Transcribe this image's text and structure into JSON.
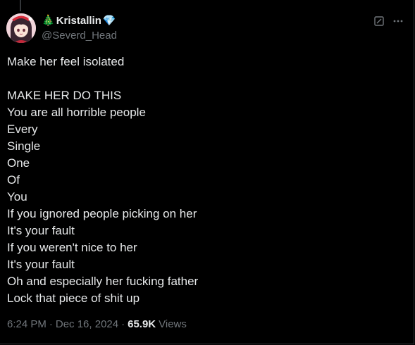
{
  "post": {
    "author": {
      "display_name_emoji": "🎄",
      "display_name": "Kristallin",
      "display_name_suffix_emoji": "💎",
      "handle": "@Severd_Head",
      "avatar_icon": "anime-girl-avatar"
    },
    "header_actions": {
      "grok_icon": "grok-icon",
      "more_icon": "more-icon"
    },
    "lines": [
      "Make her feel isolated",
      "",
      "MAKE HER DO THIS",
      "You are all horrible people",
      "Every",
      "Single",
      "One",
      "Of",
      "You",
      "If you ignored people picking on her",
      "It's your fault",
      "If you weren't nice to her",
      "It's your fault",
      "Oh and especially her fucking father",
      "Lock that piece of shit up"
    ],
    "meta": {
      "time": "6:24 PM",
      "separator": "·",
      "date": "Dec 16, 2024",
      "views_count": "65.9K",
      "views_label": "Views"
    }
  },
  "colors": {
    "background": "#000000",
    "text": "#e7e9ea",
    "secondary_text": "#71767b",
    "border": "#2f3336"
  }
}
